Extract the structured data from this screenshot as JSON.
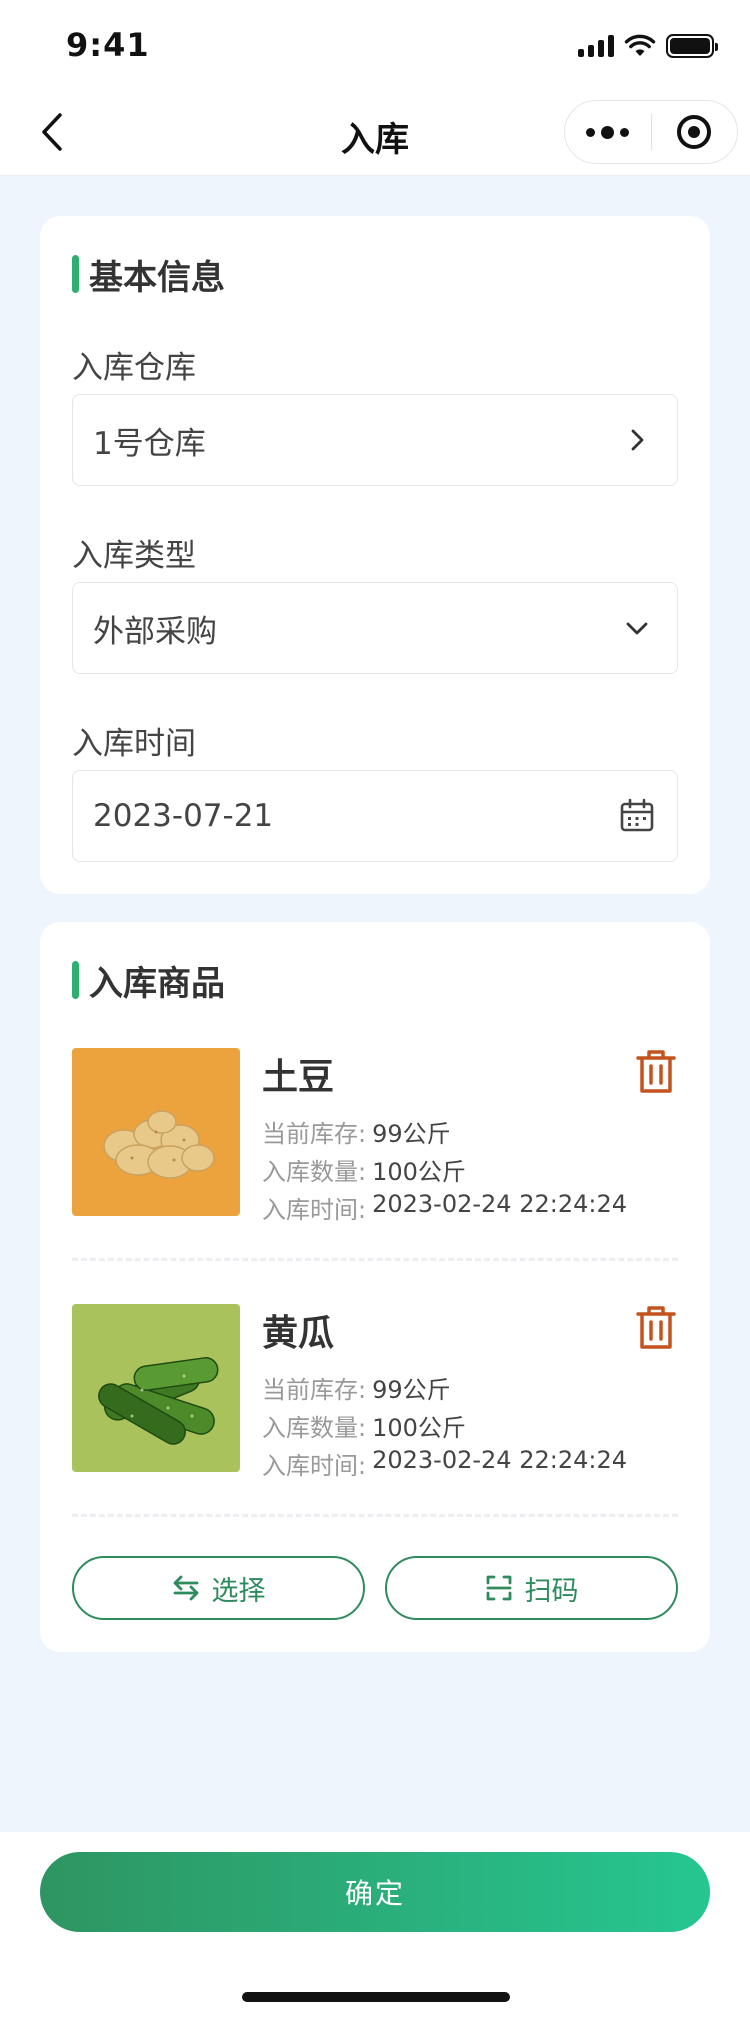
{
  "status_bar": {
    "time": "9:41"
  },
  "nav": {
    "title": "入库"
  },
  "basic_info": {
    "title": "基本信息",
    "warehouse": {
      "label": "入库仓库",
      "value": "1号仓库"
    },
    "type": {
      "label": "入库类型",
      "value": "外部采购"
    },
    "time": {
      "label": "入库时间",
      "value": "2023-07-21"
    }
  },
  "goods": {
    "title": "入库商品",
    "items": [
      {
        "name": "土豆",
        "stock_label": "当前库存:",
        "stock_value": "99公斤",
        "qty_label": "入库数量:",
        "qty_value": "100公斤",
        "time_label": "入库时间:",
        "time_value": "2023-02-24 22:24:24",
        "image_bg": "#eca33d"
      },
      {
        "name": "黄瓜",
        "stock_label": "当前库存:",
        "stock_value": "99公斤",
        "qty_label": "入库数量:",
        "qty_value": "100公斤",
        "time_label": "入库时间:",
        "time_value": "2023-02-24 22:24:24",
        "image_bg": "#a9c25c"
      }
    ],
    "select_label": "选择",
    "scan_label": "扫码"
  },
  "footer": {
    "confirm_label": "确定"
  },
  "colors": {
    "accent": "#2eae70",
    "delete": "#c4531e",
    "button_gradient_start": "#2e9562",
    "button_gradient_end": "#26c691"
  }
}
